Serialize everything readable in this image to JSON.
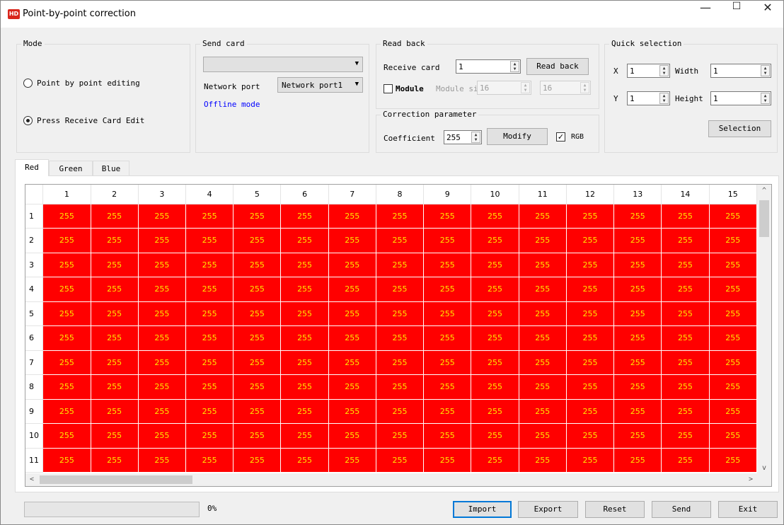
{
  "window": {
    "title": "Point-by-point correction",
    "icon_text": "HD",
    "minimize_glyph": "—",
    "maximize_glyph": "☐",
    "close_glyph": "✕"
  },
  "mode": {
    "title": "Mode",
    "option_point": "Point by point editing",
    "option_receive": "Press Receive Card Edit",
    "selected": "Press Receive Card Edit"
  },
  "send_card": {
    "title": "Send card",
    "selected": "",
    "network_port_label": "Network port",
    "network_port_value": "Network port1",
    "status": "Offline mode"
  },
  "read_back": {
    "title": "Read back",
    "receive_card_label": "Receive card",
    "receive_card_value": "1",
    "read_back_button": "Read back",
    "module_label": "Module",
    "module_checked": false,
    "module_size_label": "Module size",
    "module_width": "16",
    "module_height": "16"
  },
  "correction": {
    "title": "Correction parameter",
    "coefficient_label": "Coefficient",
    "coefficient_value": "255",
    "modify_button": "Modify",
    "rgb_label": "RGB",
    "rgb_checked": true
  },
  "quick_selection": {
    "title": "Quick selection",
    "x_label": "X",
    "x_value": "1",
    "y_label": "Y",
    "y_value": "1",
    "width_label": "Width",
    "width_value": "1",
    "height_label": "Height",
    "height_value": "1",
    "selection_button": "Selection"
  },
  "tabs": [
    {
      "label": "Red",
      "active": true
    },
    {
      "label": "Green",
      "active": false
    },
    {
      "label": "Blue",
      "active": false
    }
  ],
  "grid": {
    "columns": [
      "1",
      "2",
      "3",
      "4",
      "5",
      "6",
      "7",
      "8",
      "9",
      "10",
      "11",
      "12",
      "13",
      "14",
      "15"
    ],
    "rows": [
      "1",
      "2",
      "3",
      "4",
      "5",
      "6",
      "7",
      "8",
      "9",
      "10",
      "11"
    ],
    "cell_value": "255",
    "cell_color": "#ff0000",
    "text_color": "#ffe600"
  },
  "footer": {
    "progress_percent": 0,
    "progress_label": "0%",
    "import_button": "Import",
    "export_button": "Export",
    "reset_button": "Reset",
    "send_button": "Send",
    "exit_button": "Exit"
  },
  "icons": {
    "dropdown": "▼",
    "spin_up": "▲",
    "spin_down": "▼",
    "scroll_up": "^",
    "scroll_down": "v",
    "scroll_left": "<",
    "scroll_right": ">",
    "check": "✓"
  }
}
